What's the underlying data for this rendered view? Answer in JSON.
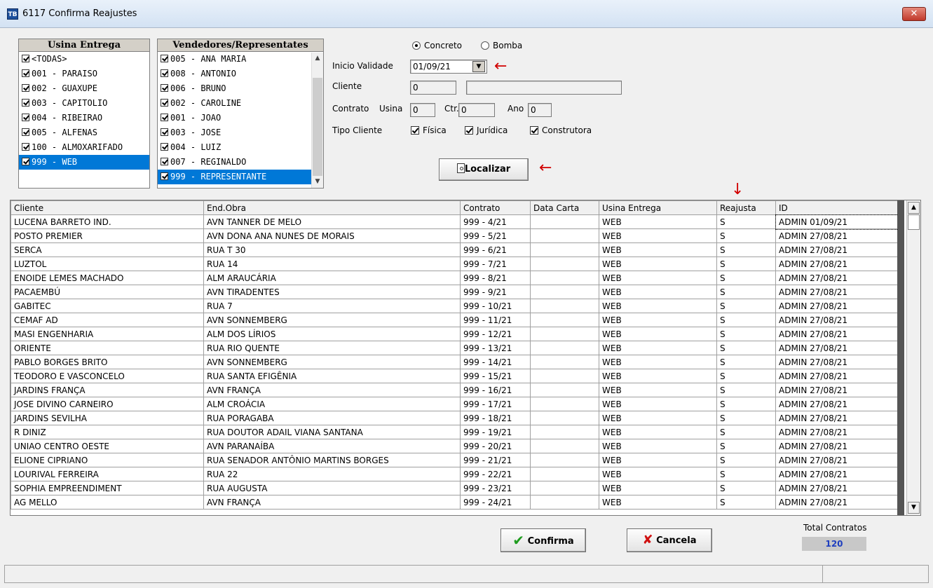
{
  "window": {
    "title": "6117 Confirma Reajustes",
    "icon_text": "TB"
  },
  "usina_list": {
    "header": "Usina Entrega",
    "items": [
      {
        "label": "<TODAS>",
        "checked": true
      },
      {
        "label": "001 - PARAISO",
        "checked": true
      },
      {
        "label": "002 - GUAXUPE",
        "checked": true
      },
      {
        "label": "003 - CAPITOLIO",
        "checked": true
      },
      {
        "label": "004 - RIBEIRAO",
        "checked": true
      },
      {
        "label": "005 - ALFENAS",
        "checked": true
      },
      {
        "label": "100 - ALMOXARIFADO",
        "checked": true
      },
      {
        "label": "999 - WEB",
        "checked": true,
        "selected": true
      }
    ]
  },
  "vendedores_list": {
    "header": "Vendedores/Representates",
    "items": [
      {
        "label": "005 - ANA MARIA",
        "checked": true
      },
      {
        "label": "008 - ANTONIO",
        "checked": true
      },
      {
        "label": "006 - BRUNO",
        "checked": true
      },
      {
        "label": "002 - CAROLINE",
        "checked": true
      },
      {
        "label": "001 - JOAO",
        "checked": true
      },
      {
        "label": "003 - JOSE",
        "checked": true
      },
      {
        "label": "004 - LUIZ",
        "checked": true
      },
      {
        "label": "007 - REGINALDO",
        "checked": true
      },
      {
        "label": "999 - REPRESENTANTE",
        "checked": true,
        "selected": true
      }
    ]
  },
  "form": {
    "radio_concreto": "Concreto",
    "radio_bomba": "Bomba",
    "inicio_validade_label": "Inicio Validade",
    "inicio_validade_value": "01/09/21",
    "cliente_label": "Cliente",
    "cliente_code": "0",
    "cliente_name": "",
    "contrato_label": "Contrato",
    "usina_label": "Usina",
    "usina_value": "0",
    "ctr_label": "Ctr.",
    "ctr_value": "0",
    "ano_label": "Ano",
    "ano_value": "0",
    "tipo_cliente_label": "Tipo Cliente",
    "fisica": "Física",
    "juridica": "Jurídica",
    "construtora": "Construtora",
    "localizar": "Localizar"
  },
  "grid": {
    "columns": [
      "Cliente",
      "End.Obra",
      "Contrato",
      "Data Carta",
      "Usina Entrega",
      "Reajusta",
      "ID"
    ],
    "rows": [
      [
        "LUCENA BARRETO IND.",
        "AVN TANNER DE MELO",
        "999 - 4/21",
        "",
        "WEB",
        "S",
        "ADMIN 01/09/21"
      ],
      [
        "POSTO PREMIER",
        "AVN DONA ANA NUNES DE MORAIS",
        "999 - 5/21",
        "",
        "WEB",
        "S",
        "ADMIN 27/08/21"
      ],
      [
        "SERCA",
        "RUA T 30",
        "999 - 6/21",
        "",
        "WEB",
        "S",
        "ADMIN 27/08/21"
      ],
      [
        "LUZTOL",
        "RUA 14",
        "999 - 7/21",
        "",
        "WEB",
        "S",
        "ADMIN 27/08/21"
      ],
      [
        "ENOIDE LEMES MACHADO",
        "ALM ARAUCÁRIA",
        "999 - 8/21",
        "",
        "WEB",
        "S",
        "ADMIN 27/08/21"
      ],
      [
        "PACAEMBÚ",
        "AVN TIRADENTES",
        "999 - 9/21",
        "",
        "WEB",
        "S",
        "ADMIN 27/08/21"
      ],
      [
        "GABITEC",
        "RUA 7",
        "999 - 10/21",
        "",
        "WEB",
        "S",
        "ADMIN 27/08/21"
      ],
      [
        "CEMAF AD",
        "AVN SONNEMBERG",
        "999 - 11/21",
        "",
        "WEB",
        "S",
        "ADMIN 27/08/21"
      ],
      [
        "MASI ENGENHARIA",
        "ALM DOS LÍRIOS",
        "999 - 12/21",
        "",
        "WEB",
        "S",
        "ADMIN 27/08/21"
      ],
      [
        "ORIENTE",
        "RUA RIO QUENTE",
        "999 - 13/21",
        "",
        "WEB",
        "S",
        "ADMIN 27/08/21"
      ],
      [
        "PABLO BORGES BRITO",
        "AVN SONNEMBERG",
        "999 - 14/21",
        "",
        "WEB",
        "S",
        "ADMIN 27/08/21"
      ],
      [
        "TEODORO E VASCONCELO",
        "RUA SANTA EFIGÊNIA",
        "999 - 15/21",
        "",
        "WEB",
        "S",
        "ADMIN 27/08/21"
      ],
      [
        "JARDINS FRANÇA",
        "AVN FRANÇA",
        "999 - 16/21",
        "",
        "WEB",
        "S",
        "ADMIN 27/08/21"
      ],
      [
        "JOSE DIVINO CARNEIRO",
        "ALM CROÁCIA",
        "999 - 17/21",
        "",
        "WEB",
        "S",
        "ADMIN 27/08/21"
      ],
      [
        "JARDINS SEVILHA",
        "RUA PORAGABA",
        "999 - 18/21",
        "",
        "WEB",
        "S",
        "ADMIN 27/08/21"
      ],
      [
        "R DINIZ",
        "RUA DOUTOR ADAIL VIANA SANTANA",
        "999 - 19/21",
        "",
        "WEB",
        "S",
        "ADMIN 27/08/21"
      ],
      [
        "UNIAO CENTRO OESTE",
        "AVN PARANAÍBA",
        "999 - 20/21",
        "",
        "WEB",
        "S",
        "ADMIN 27/08/21"
      ],
      [
        "ELIONE CIPRIANO",
        "RUA SENADOR ANTÔNIO MARTINS BORGES",
        "999 - 21/21",
        "",
        "WEB",
        "S",
        "ADMIN 27/08/21"
      ],
      [
        "LOURIVAL FERREIRA",
        "RUA 22",
        "999 - 22/21",
        "",
        "WEB",
        "S",
        "ADMIN 27/08/21"
      ],
      [
        "SOPHIA EMPREENDIMENT",
        "RUA AUGUSTA",
        "999 - 23/21",
        "",
        "WEB",
        "S",
        "ADMIN 27/08/21"
      ],
      [
        "AG MELLO",
        "AVN FRANÇA",
        "999 - 24/21",
        "",
        "WEB",
        "S",
        "ADMIN 27/08/21"
      ]
    ]
  },
  "footer": {
    "confirma": "Confirma",
    "cancela": "Cancela",
    "total_label": "Total Contratos",
    "total_value": "120"
  },
  "colors": {
    "selection": "#0078d7",
    "annotation_arrow": "#d10000",
    "total_value": "#1f3fbf"
  }
}
